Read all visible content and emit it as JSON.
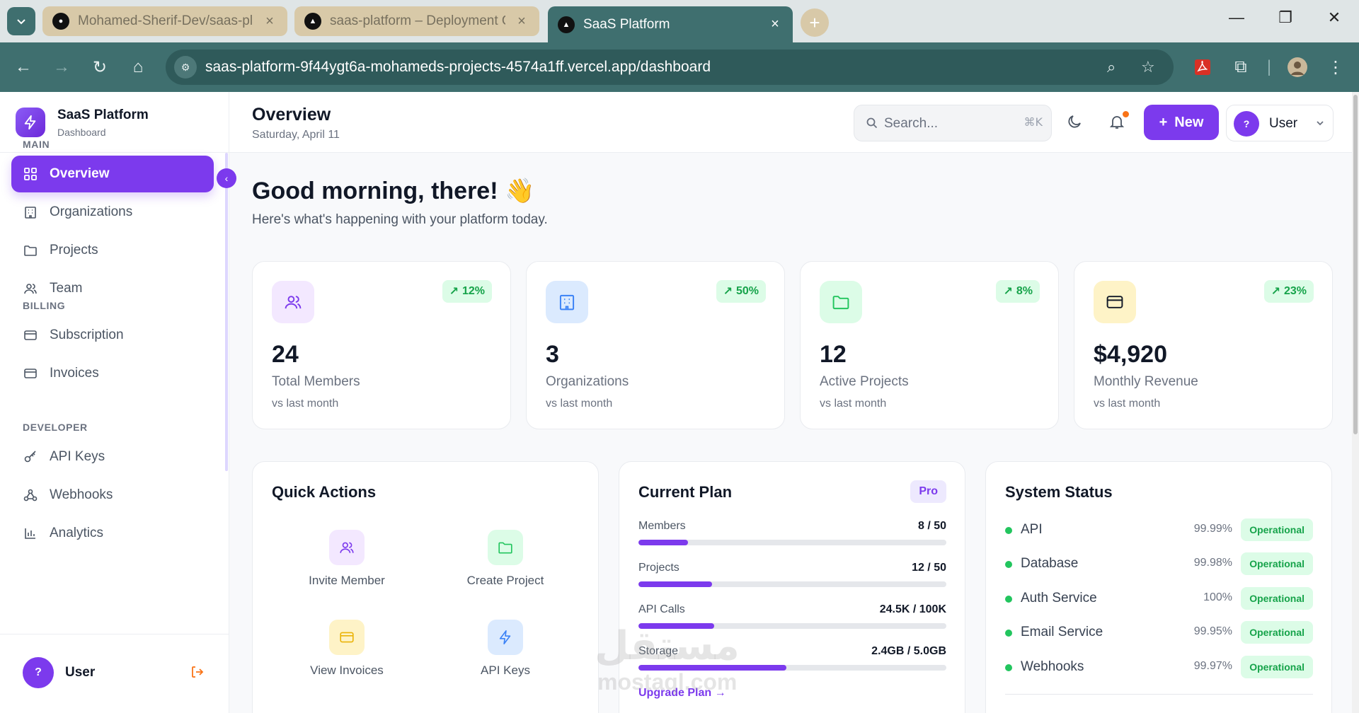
{
  "browser": {
    "tabs": [
      {
        "title": "Mohamed-Sherif-Dev/saas-plat"
      },
      {
        "title": "saas-platform – Deployment Ov"
      },
      {
        "title": "SaaS Platform"
      }
    ],
    "url": "saas-platform-9f44ygt6a-mohameds-projects-4574a1ff.vercel.app/dashboard"
  },
  "brand": {
    "name": "SaaS Platform",
    "sub": "Dashboard"
  },
  "sidebar": {
    "sections": [
      {
        "label": "MAIN",
        "items": [
          {
            "label": "Overview",
            "icon": "grid-icon",
            "active": true
          },
          {
            "label": "Organizations",
            "icon": "building-icon"
          },
          {
            "label": "Projects",
            "icon": "folder-icon"
          },
          {
            "label": "Team",
            "icon": "users-icon"
          }
        ]
      },
      {
        "label": "BILLING",
        "items": [
          {
            "label": "Subscription",
            "icon": "card-icon"
          },
          {
            "label": "Invoices",
            "icon": "card-icon"
          }
        ]
      },
      {
        "label": "DEVELOPER",
        "items": [
          {
            "label": "API Keys",
            "icon": "key-icon"
          },
          {
            "label": "Webhooks",
            "icon": "webhook-icon"
          },
          {
            "label": "Analytics",
            "icon": "chart-icon"
          }
        ]
      }
    ],
    "footer": {
      "avatar": "?",
      "name": "User"
    }
  },
  "header": {
    "title": "Overview",
    "date": "Saturday, April 11",
    "search_placeholder": "Search...",
    "search_shortcut": "⌘K",
    "new_label": "New",
    "user_avatar": "?",
    "user_label": "User"
  },
  "greeting": {
    "title": "Good morning, there! 👋",
    "subtitle": "Here's what's happening with your platform today."
  },
  "stats": [
    {
      "value": "24",
      "label": "Total Members",
      "sub": "vs last month",
      "trend": "12%",
      "icon": "users-icon",
      "color": "#7c3aed",
      "bg": "#f3e8ff"
    },
    {
      "value": "3",
      "label": "Organizations",
      "sub": "vs last month",
      "trend": "50%",
      "icon": "building-icon",
      "color": "#3b82f6",
      "bg": "#dbeafe"
    },
    {
      "value": "12",
      "label": "Active Projects",
      "sub": "vs last month",
      "trend": "8%",
      "icon": "folder-icon",
      "color": "#22c55e",
      "bg": "#dcfce7"
    },
    {
      "value": "$4,920",
      "label": "Monthly Revenue",
      "sub": "vs last month",
      "trend": "23%",
      "icon": "card-icon",
      "color": "#111827",
      "bg": "#fef3c7"
    }
  ],
  "quick_actions": {
    "title": "Quick Actions",
    "items": [
      {
        "label": "Invite Member",
        "icon": "users-icon",
        "color": "#7c3aed",
        "bg": "#f3e8ff"
      },
      {
        "label": "Create Project",
        "icon": "folder-icon",
        "color": "#22c55e",
        "bg": "#dcfce7"
      },
      {
        "label": "View Invoices",
        "icon": "card-icon",
        "color": "#eab308",
        "bg": "#fef3c7"
      },
      {
        "label": "API Keys",
        "icon": "bolt-icon",
        "color": "#3b82f6",
        "bg": "#dbeafe"
      }
    ]
  },
  "plan": {
    "title": "Current Plan",
    "badge": "Pro",
    "meters": [
      {
        "label": "Members",
        "value": "8 / 50",
        "fraction": 0.16
      },
      {
        "label": "Projects",
        "value": "12 / 50",
        "fraction": 0.24
      },
      {
        "label": "API Calls",
        "value": "24.5K / 100K",
        "fraction": 0.245
      },
      {
        "label": "Storage",
        "value": "2.4GB / 5.0GB",
        "fraction": 0.48
      }
    ],
    "upgrade_label": "Upgrade Plan →"
  },
  "system_status": {
    "title": "System Status",
    "services": [
      {
        "name": "API",
        "uptime": "99.99%",
        "status": "Operational"
      },
      {
        "name": "Database",
        "uptime": "99.98%",
        "status": "Operational"
      },
      {
        "name": "Auth Service",
        "uptime": "100%",
        "status": "Operational"
      },
      {
        "name": "Email Service",
        "uptime": "99.95%",
        "status": "Operational"
      },
      {
        "name": "Webhooks",
        "uptime": "99.97%",
        "status": "Operational"
      }
    ]
  },
  "watermark": {
    "line1": "مستقل",
    "line2": "mostaql.com"
  }
}
